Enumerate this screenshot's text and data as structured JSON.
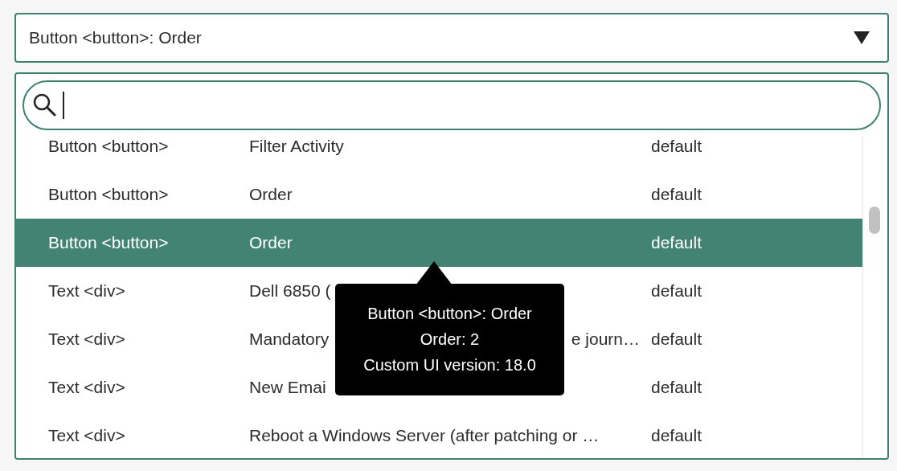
{
  "dropdown": {
    "value": "Button <button>: Order",
    "expanded": true
  },
  "rows": [
    {
      "element": "Button <button>",
      "label": "Filter Activity",
      "column_3": "default",
      "selected": false
    },
    {
      "element": "Button <button>",
      "label": "Order",
      "column_3": "default",
      "selected": false
    },
    {
      "element": "Button <button>",
      "label": "Order",
      "column_3": "default",
      "selected": true
    },
    {
      "element": "Text <div>",
      "label": "Dell 6850 (",
      "column_3": "default",
      "selected": false
    },
    {
      "element": "Text <div>",
      "label": "Mandatory",
      "label_tail": "e journ…",
      "column_3": "default",
      "selected": false
    },
    {
      "element": "Text <div>",
      "label": "New Emai",
      "column_3": "default",
      "selected": false
    },
    {
      "element": "Text <div>",
      "label": "Reboot a Windows Server (after patching or …",
      "column_3": "default",
      "selected": false
    }
  ],
  "tooltip": {
    "lines": [
      "Button <button>: Order",
      "Order: 2",
      "Custom UI version: 18.0"
    ]
  }
}
